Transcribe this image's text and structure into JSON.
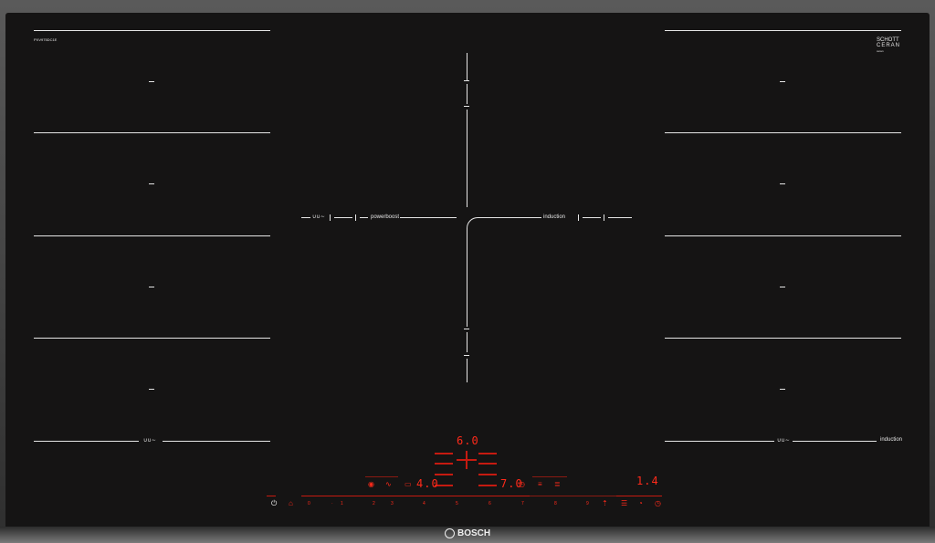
{
  "model_code": "PXV975DC1E",
  "glass_brand": {
    "line1": "SCHOTT",
    "line2": "CERAN",
    "line3": "ceran"
  },
  "labels": {
    "powerboost": "powerboost",
    "induction_center": "induction",
    "induction_right": "induction"
  },
  "wave_glyph": "∪∪∼",
  "displays": {
    "top": "6.0",
    "left": "4.0",
    "center": "7.0",
    "right": "1.4"
  },
  "slider_numbers": [
    "0",
    "1",
    "2",
    "3",
    "4",
    "5",
    "6",
    "7",
    "8",
    "9"
  ],
  "brand": "BOSCH",
  "colors": {
    "accent": "#ff2a1a",
    "line": "#e6e6e6",
    "glass": "#151414"
  }
}
